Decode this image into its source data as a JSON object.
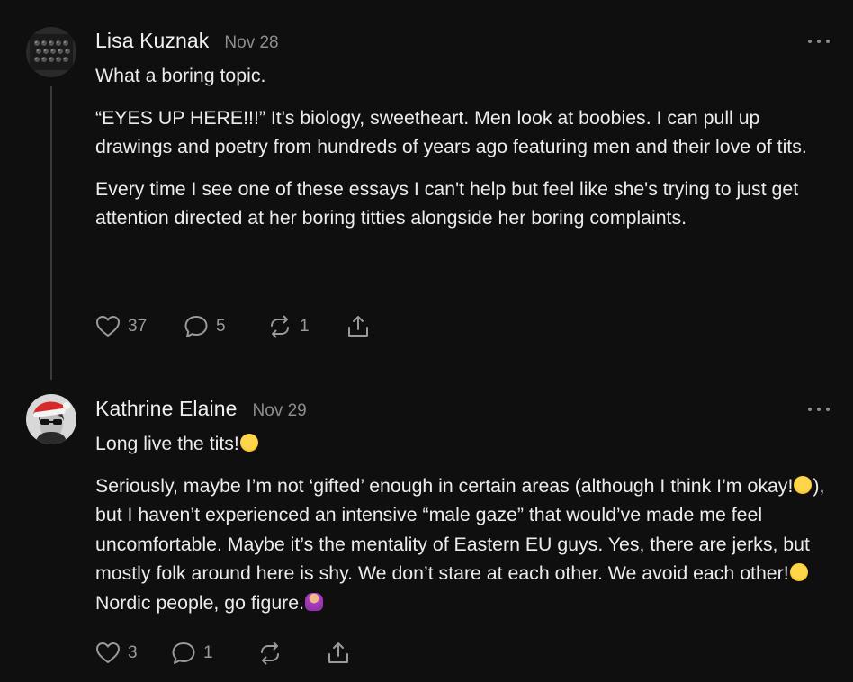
{
  "comments": [
    {
      "author": "Lisa Kuznak",
      "date": "Nov 28",
      "avatar": "keyboard-avatar",
      "paragraphs": [
        "What a boring topic.",
        "“EYES UP HERE!!!” It's biology, sweetheart. Men look at boobies. I can pull up drawings and poetry from hundreds of years ago featuring men and their love of tits.",
        "Every time I see one of these essays I can't help but feel like she's trying to just get attention directed at her boring titties alongside her boring complaints."
      ],
      "likes": "37",
      "replies": "5",
      "restacks": "1"
    },
    {
      "author": "Kathrine Elaine",
      "date": "Nov 29",
      "avatar": "santa-hat-avatar",
      "p1": "Long live the tits!",
      "p2a": "Seriously, maybe I’m not ‘gifted’ enough in certain areas (although I think I’m okay!",
      "p2b": "), but I haven’t experienced an intensive “male gaze” that would’ve made me feel uncomfortable. Maybe it’s the mentality of Eastern EU guys. Yes, there are jerks, but mostly folk around here is shy. We don’t stare at each other. We avoid each other!",
      "p2c": " Nordic people, go figure.",
      "likes": "3",
      "replies": "1"
    }
  ],
  "icons": {
    "like": "heart-icon",
    "reply": "speech-bubble-icon",
    "restack": "restack-arrows-icon",
    "share": "share-upload-icon",
    "more": "ellipsis-icon"
  },
  "colors": {
    "background": "#0f0f0f",
    "text": "#ececec",
    "muted": "#8d8d8d",
    "icon": "#9a9a9a",
    "thread_line": "#3a3a3a"
  }
}
